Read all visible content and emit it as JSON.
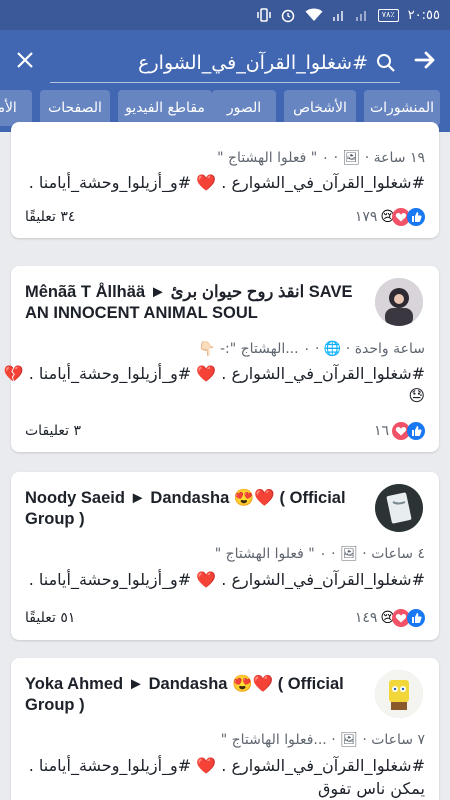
{
  "status_bar": {
    "time": "٢٠:٥٥",
    "battery": "٧٨٪",
    "colors": {
      "bar": "#3b5998"
    }
  },
  "search": {
    "query": "#شغلوا_القرآن_في_الشوارع",
    "icons": {
      "close": "close-icon",
      "search": "search-icon",
      "back": "arrow-right-icon"
    }
  },
  "tabs": [
    {
      "label": "المنشورات"
    },
    {
      "label": "الأشخاص"
    },
    {
      "label": "الصور"
    },
    {
      "label": "مقاطع الفيديو"
    },
    {
      "label": "الصفحات"
    },
    {
      "label": "الأما"
    }
  ],
  "posts": [
    {
      "meta": "١٩ ساعة · 🖼 · ٠ \" فعلوا الهشتاج \"",
      "line1": "#شغلوا_القرآن_في_الشوارع . ❤️ #و_أزيلوا_وحشة_أيامنا .",
      "comments": "٣٤ تعليقًا",
      "reaction_count": "١٧٩"
    },
    {
      "title": "Mênãã T Ållhää ▶ انقذ روح حيوان برئ SAVE AN INNOCENT ANIMAL SOUL",
      "title_line1": "Mênãã T Ållhää ► انقذ روح حيوان برئ SAVE",
      "title_line2": "AN INNOCENT ANIMAL SOUL",
      "meta": "ساعة واحدة · 🌐 · ٠ ...الهشتاج \":- 👇🏻",
      "line1": "#شغلوا_القرآن_في_الشوارع . ❤️ #و_أزيلوا_وحشة_أيامنا . 💔",
      "line2": "😓",
      "comments": "٣ تعليقات",
      "reaction_count": "١٦"
    },
    {
      "title_line1": "Noody Saeid ► Dandasha 😍❤️ ( Official",
      "title_line2": "Group )",
      "meta": "٤ ساعات · 🖼 · ٠ \" فعلوا الهشتاج \"",
      "line1": "#شغلوا_القرآن_في_الشوارع . ❤️ #و_أزيلوا_وحشة_أيامنا .",
      "comments": "٥١ تعليقًا",
      "reaction_count": "١٤٩"
    },
    {
      "title_line1": "Yoka Ahmed ► Dandasha 😍❤️ ( Official",
      "title_line2": "Group )",
      "meta": "٧ ساعات · 🖼 · ...فعلوا الهاشتاج \"",
      "line1": "#شغلوا_القرآن_في_الشوارع . ❤️ #و_أزيلوا_وحشة_أيامنا .",
      "line2": "يمكن ناس تفوق"
    }
  ]
}
